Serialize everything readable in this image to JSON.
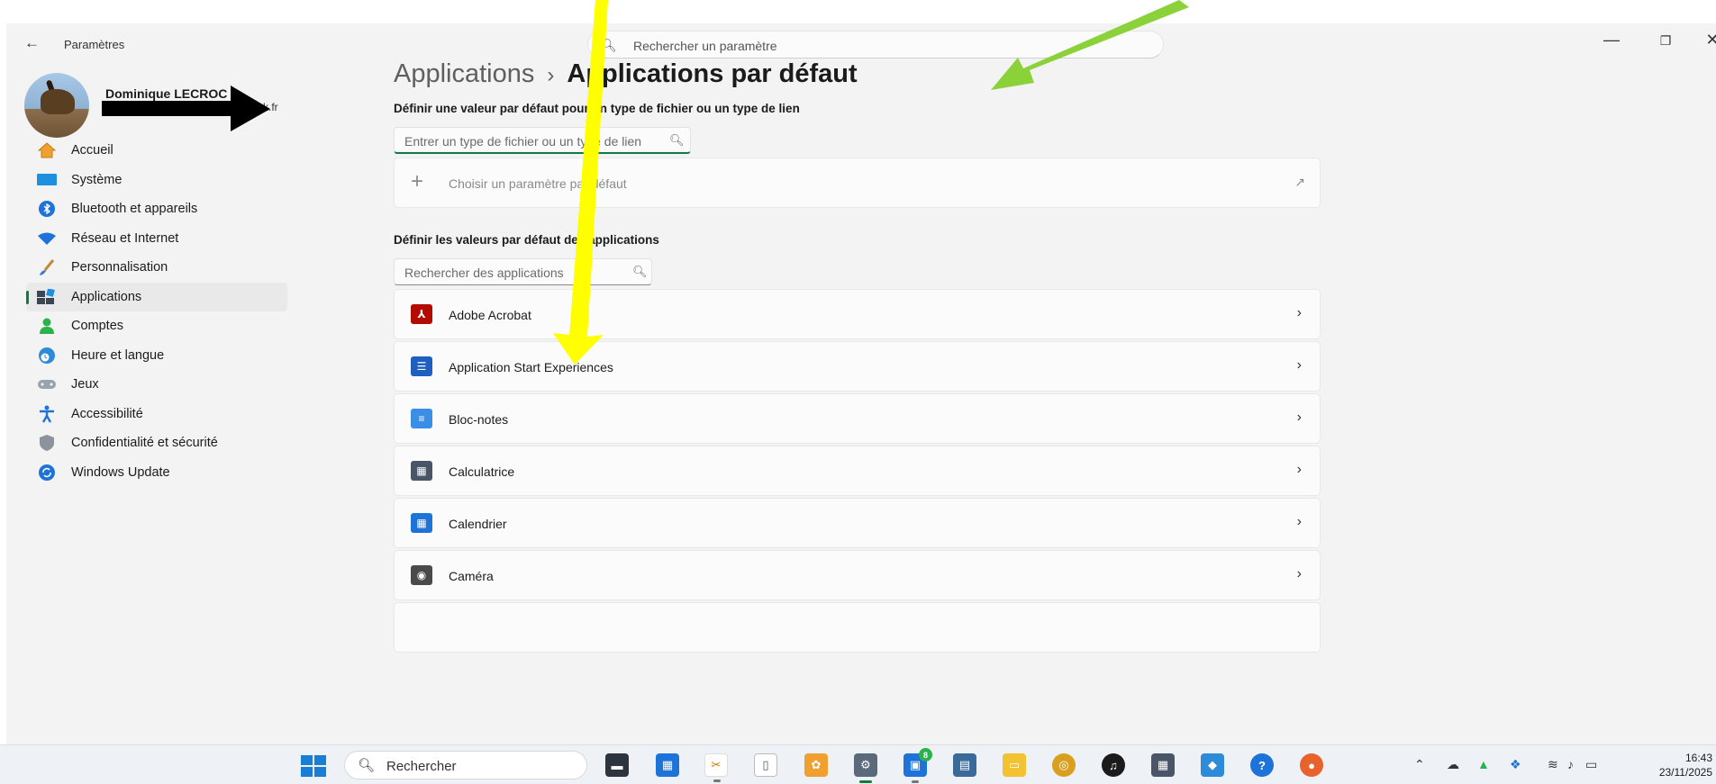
{
  "window": {
    "title": "Paramètres",
    "search_placeholder": "Rechercher un paramètre",
    "minimize": "—",
    "maximize": "❐",
    "close": "✕"
  },
  "user": {
    "name": "Dominique LECROC",
    "email_fragment": "k.fr"
  },
  "sidebar": {
    "items": [
      {
        "label": "Accueil",
        "icon": "home-icon"
      },
      {
        "label": "Système",
        "icon": "system-icon"
      },
      {
        "label": "Bluetooth et appareils",
        "icon": "bluetooth-icon"
      },
      {
        "label": "Réseau et Internet",
        "icon": "wifi-icon"
      },
      {
        "label": "Personnalisation",
        "icon": "brush-icon"
      },
      {
        "label": "Applications",
        "icon": "apps-icon",
        "active": true
      },
      {
        "label": "Comptes",
        "icon": "person-icon"
      },
      {
        "label": "Heure et langue",
        "icon": "globe-clock-icon"
      },
      {
        "label": "Jeux",
        "icon": "gamepad-icon"
      },
      {
        "label": "Accessibilité",
        "icon": "accessibility-icon"
      },
      {
        "label": "Confidentialité et sécurité",
        "icon": "shield-icon"
      },
      {
        "label": "Windows Update",
        "icon": "update-icon"
      }
    ]
  },
  "breadcrumb": {
    "parent": "Applications",
    "separator": "›",
    "current": "Applications par défaut"
  },
  "file_section": {
    "title": "Définir une valeur par défaut pour un type de fichier ou un type de lien",
    "input_placeholder": "Entrer un type de fichier ou un type de lien",
    "choose_label": "Choisir un paramètre par défaut"
  },
  "apps_section": {
    "title": "Définir les valeurs par défaut des applications",
    "search_placeholder": "Rechercher des applications",
    "apps": [
      {
        "name": "Adobe Acrobat",
        "icon": "acrobat-icon",
        "color": "#b30b00"
      },
      {
        "name": "Application Start Experiences",
        "icon": "start-experiences-icon",
        "color": "#1f5fbf"
      },
      {
        "name": "Bloc-notes",
        "icon": "notepad-icon",
        "color": "#3a8ee6"
      },
      {
        "name": "Calculatrice",
        "icon": "calculator-icon",
        "color": "#4a5568"
      },
      {
        "name": "Calendrier",
        "icon": "calendar-icon",
        "color": "#1e73d8"
      },
      {
        "name": "Caméra",
        "icon": "camera-icon",
        "color": "#4a4a4a"
      }
    ]
  },
  "taskbar": {
    "search_placeholder": "Rechercher",
    "badge_count": "8",
    "time": "16:43",
    "date": "23/11/2025"
  },
  "colors": {
    "accent": "#0f7b3f",
    "arrow_yellow": "#ffff00",
    "arrow_green": "#8bd13a",
    "arrow_black": "#000000"
  }
}
